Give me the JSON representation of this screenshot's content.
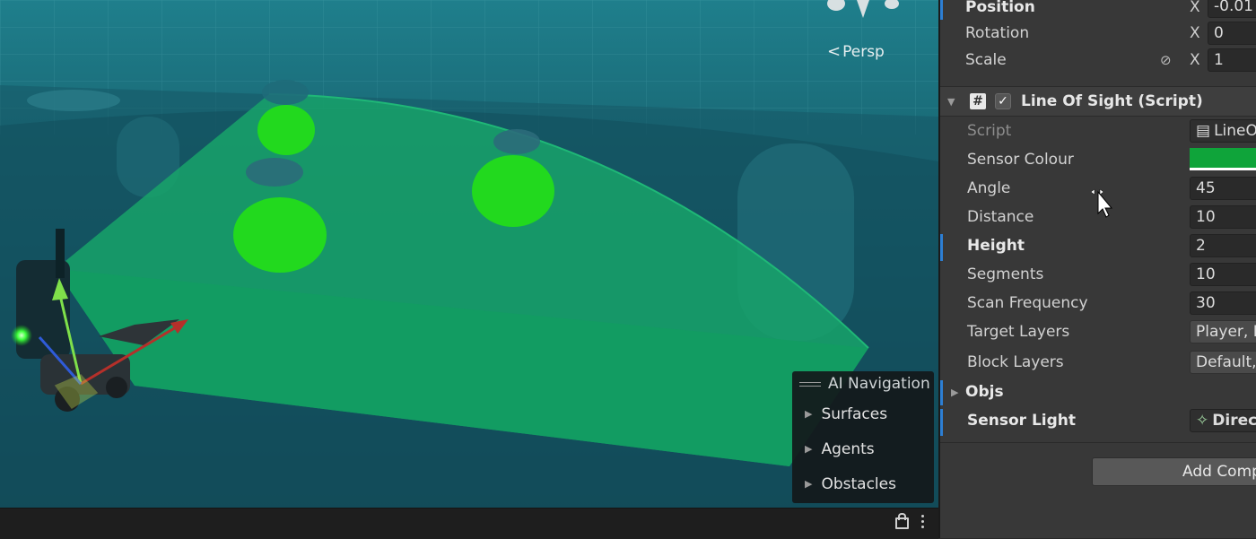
{
  "scene": {
    "view_mode": "Persp",
    "ai_navigation": {
      "title": "AI Navigation",
      "items": [
        "Surfaces",
        "Agents",
        "Obstacles"
      ]
    }
  },
  "inspector": {
    "transform": {
      "position_label": "Position",
      "position_axis": "X",
      "position_x": "-0.01",
      "rotation_label": "Rotation",
      "rotation_axis": "X",
      "rotation_x": "0",
      "scale_label": "Scale",
      "scale_axis": "X",
      "scale_x": "1"
    },
    "component": {
      "title": "Line Of Sight (Script)",
      "fields": {
        "script_label": "Script",
        "script_value": "LineO",
        "sensor_colour_label": "Sensor Colour",
        "sensor_colour": "#0fa43a",
        "angle_label": "Angle",
        "angle_value": "45",
        "distance_label": "Distance",
        "distance_value": "10",
        "height_label": "Height",
        "height_value": "2",
        "segments_label": "Segments",
        "segments_value": "10",
        "scan_frequency_label": "Scan Frequency",
        "scan_frequency_value": "30",
        "target_layers_label": "Target Layers",
        "target_layers_value": "Player, I",
        "block_layers_label": "Block Layers",
        "block_layers_value": "Default,",
        "objs_label": "Objs",
        "sensor_light_label": "Sensor Light",
        "sensor_light_value": "Direct"
      }
    },
    "add_component_label": "Add Comp"
  },
  "colors": {
    "accent_blue": "#2d7fd4",
    "sensor_green": "#0fa43a",
    "inspector_bg": "#383838"
  }
}
